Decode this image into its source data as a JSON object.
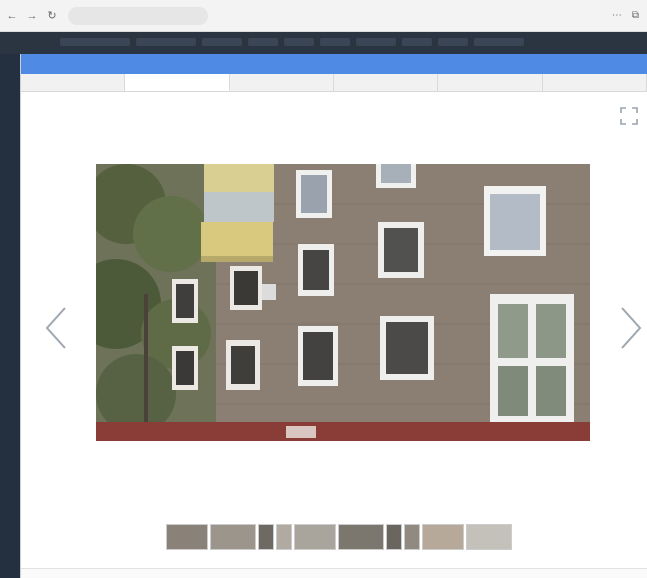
{
  "browser": {
    "back_icon": "arrow-left-icon",
    "forward_icon": "arrow-right-icon",
    "reload_icon": "reload-icon",
    "url_host": "",
    "url_path": ""
  },
  "modal": {
    "title": "",
    "tabs": [
      {
        "label": "",
        "active": false
      },
      {
        "label": "",
        "active": true
      },
      {
        "label": "",
        "active": false
      },
      {
        "label": "",
        "active": false
      },
      {
        "label": "",
        "active": false
      },
      {
        "label": "",
        "active": false
      }
    ]
  },
  "gallery": {
    "counter": "",
    "thumbnails": 10,
    "current": 2
  },
  "colors": {
    "title_bar": "#4f8be4",
    "tab_bar": "#f1f1f1"
  }
}
